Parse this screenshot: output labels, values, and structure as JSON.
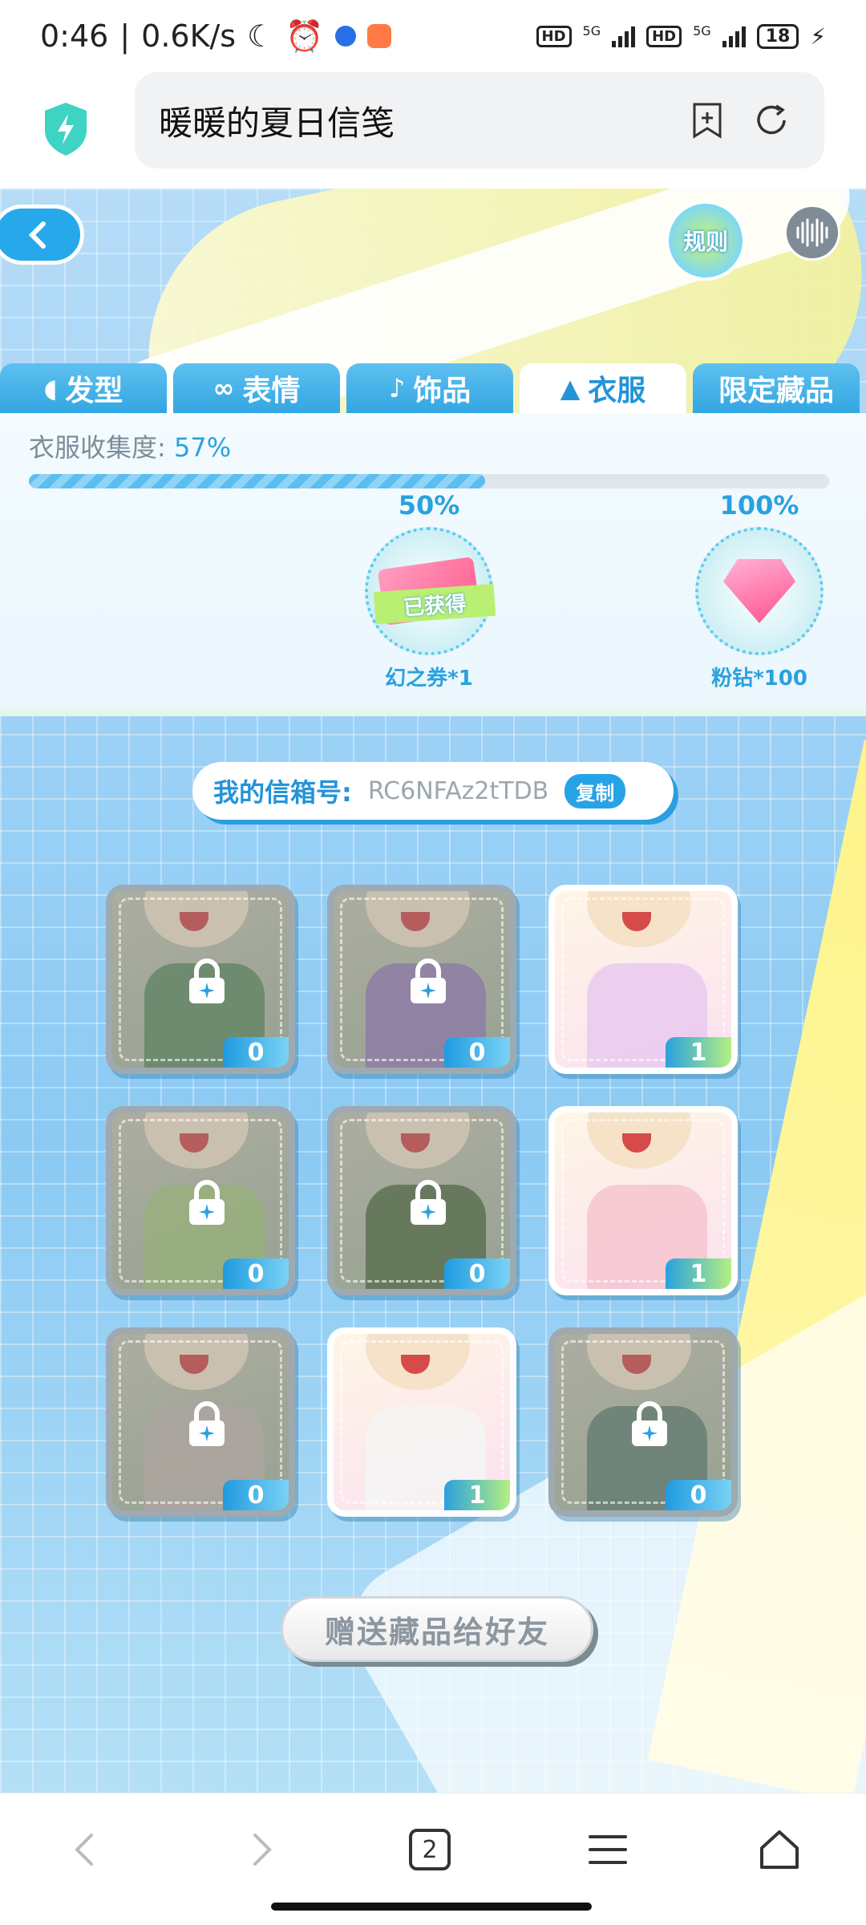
{
  "status_bar": {
    "time": "0:46",
    "speed": "0.6K/s",
    "battery": "18",
    "network1": "5G",
    "network2": "5G",
    "hd": "HD"
  },
  "browser": {
    "page_title": "暖暖的夏日信笺"
  },
  "game": {
    "rule_label": "规则",
    "tabs": [
      {
        "label": "发型",
        "icon": "hair-icon",
        "active": false
      },
      {
        "label": "表情",
        "icon": "mask-icon",
        "active": false
      },
      {
        "label": "饰品",
        "icon": "accessory-icon",
        "active": false
      },
      {
        "label": "衣服",
        "icon": "clothes-icon",
        "active": true
      },
      {
        "label": "限定藏品",
        "icon": "",
        "active": false
      }
    ],
    "collection": {
      "label": "衣服收集度:",
      "value": "57%",
      "progress_fraction": 0.57
    },
    "milestones": [
      {
        "pct": "50%",
        "reward": "幻之券*1",
        "status": "已获得"
      },
      {
        "pct": "100%",
        "reward": "粉钻*100"
      }
    ],
    "mailbox": {
      "label": "我的信箱号:",
      "code": "RC6NFAz2tTDB",
      "copy_label": "复制"
    },
    "items": [
      {
        "count": "0",
        "locked": true,
        "color": "#5c8a5a"
      },
      {
        "count": "0",
        "locked": true,
        "color": "#9a7ab8"
      },
      {
        "count": "1",
        "locked": false,
        "color": "#e9c9f0"
      },
      {
        "count": "0",
        "locked": true,
        "color": "#a9c97a"
      },
      {
        "count": "0",
        "locked": true,
        "color": "#4f6a3a"
      },
      {
        "count": "1",
        "locked": false,
        "color": "#f6c4d0"
      },
      {
        "count": "0",
        "locked": true,
        "color": "#c9b7b0"
      },
      {
        "count": "1",
        "locked": false,
        "color": "#f4f4f4"
      },
      {
        "count": "0",
        "locked": true,
        "color": "#5f7d6e"
      }
    ],
    "gift_button": "赠送藏品给好友"
  },
  "bottom_nav": {
    "tab_count": "2"
  },
  "colors": {
    "accent": "#2394d8",
    "tab_bg": "#3aa9e6"
  }
}
